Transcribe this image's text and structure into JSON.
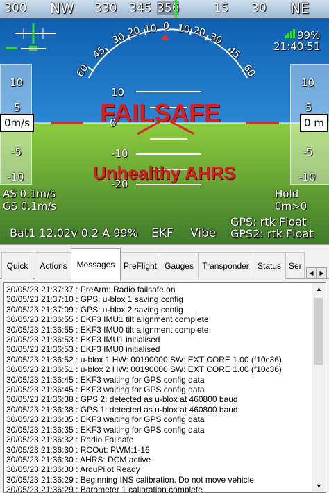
{
  "heading_tape": {
    "labels": [
      "300",
      "NW",
      "330",
      "345",
      "356",
      "15",
      "30",
      "NE"
    ],
    "current": "356"
  },
  "pitch_arc_labels": [
    "60",
    "45",
    "30",
    "20",
    "10",
    "0",
    "10",
    "20",
    "30",
    "45",
    "60"
  ],
  "pitch_ladder": [
    "10",
    "0",
    "-10",
    "-20"
  ],
  "speed_tape": {
    "ticks": [
      "10",
      "5",
      "-5",
      "-10"
    ],
    "readout": "0m/s"
  },
  "alt_tape": {
    "ticks": [
      "10",
      "5",
      "-5",
      "-10"
    ],
    "readout": "0 m"
  },
  "gps_signal": "99%",
  "clock": "21:40:51",
  "alerts": {
    "failsafe": "FAILSAFE",
    "reason": "Unhealthy AHRS"
  },
  "airspeed": "AS 0.1m/s",
  "groundspeed": "GS 0.1m/s",
  "mode": "Hold",
  "distance": "0m>0",
  "battery": "Bat1 12.02v 0.2 A 99%",
  "ekf": "EKF",
  "vibe": "Vibe",
  "gps1": "GPS: rtk Float",
  "gps2": "GPS2: rtk Float",
  "colors": {
    "sky": "#1473c9",
    "ground": "#6aa437",
    "warning": "#d42020"
  },
  "tabs": [
    "Quick",
    "Actions",
    "Messages",
    "PreFlight",
    "Gauges",
    "Transponder",
    "Status",
    "Ser"
  ],
  "active_tab": "Messages",
  "messages": [
    "30/05/23 21:37:37 : PreArm: Radio failsafe on",
    "30/05/23 21:37:10 : GPS: u-blox 1 saving config",
    "30/05/23 21:37:09 : GPS: u-blox 2 saving config",
    "30/05/23 21:36:55 : EKF3 IMU1 tilt alignment complete",
    "30/05/23 21:36:55 : EKF3 IMU0 tilt alignment complete",
    "30/05/23 21:36:53 : EKF3 IMU1 initialised",
    "30/05/23 21:36:53 : EKF3 IMU0 initialised",
    "30/05/23 21:36:52 : u-blox 1 HW: 00190000 SW: EXT CORE 1.00 (f10c36)",
    "30/05/23 21:36:51 : u-blox 2 HW: 00190000 SW: EXT CORE 1.00 (f10c36)",
    "30/05/23 21:36:45 : EKF3 waiting for GPS config data",
    "30/05/23 21:36:45 : EKF3 waiting for GPS config data",
    "30/05/23 21:36:38 : GPS 2: detected as u-blox at 460800 baud",
    "30/05/23 21:36:38 : GPS 1: detected as u-blox at 460800 baud",
    "30/05/23 21:36:35 : EKF3 waiting for GPS config data",
    "30/05/23 21:36:35 : EKF3 waiting for GPS config data",
    "30/05/23 21:36:32 : Radio Failsafe",
    "30/05/23 21:36:30 : RCOut: PWM:1-16",
    "30/05/23 21:36:30 : AHRS: DCM active",
    "30/05/23 21:36:30 : ArduPilot Ready",
    "30/05/23 21:36:29 : Beginning INS calibration. Do not move vehicle",
    "30/05/23 21:36:29 : Barometer 1 calibration complete"
  ]
}
